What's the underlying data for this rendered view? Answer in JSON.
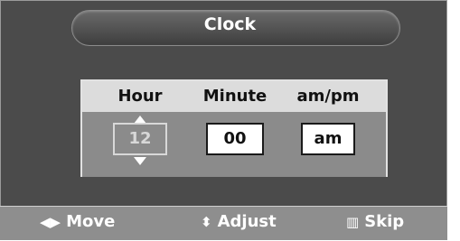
{
  "window": {
    "title": "Clock"
  },
  "panel": {
    "columns": [
      {
        "label": "Hour",
        "value": "12"
      },
      {
        "label": "Minute",
        "value": "00"
      },
      {
        "label": "am/pm",
        "value": "am"
      }
    ]
  },
  "footer": {
    "hints": [
      {
        "icon": "left-right-arrows-icon",
        "label": "Move"
      },
      {
        "icon": "up-down-arrows-icon",
        "label": "Adjust"
      },
      {
        "icon": "skip-icon",
        "label": "Skip"
      }
    ]
  },
  "colors": {
    "background": "#4b4b4b",
    "panel_header": "#dcdcdc",
    "panel_body": "#8b8b8b",
    "footer": "#8e8e8e",
    "text": "#ffffff"
  }
}
